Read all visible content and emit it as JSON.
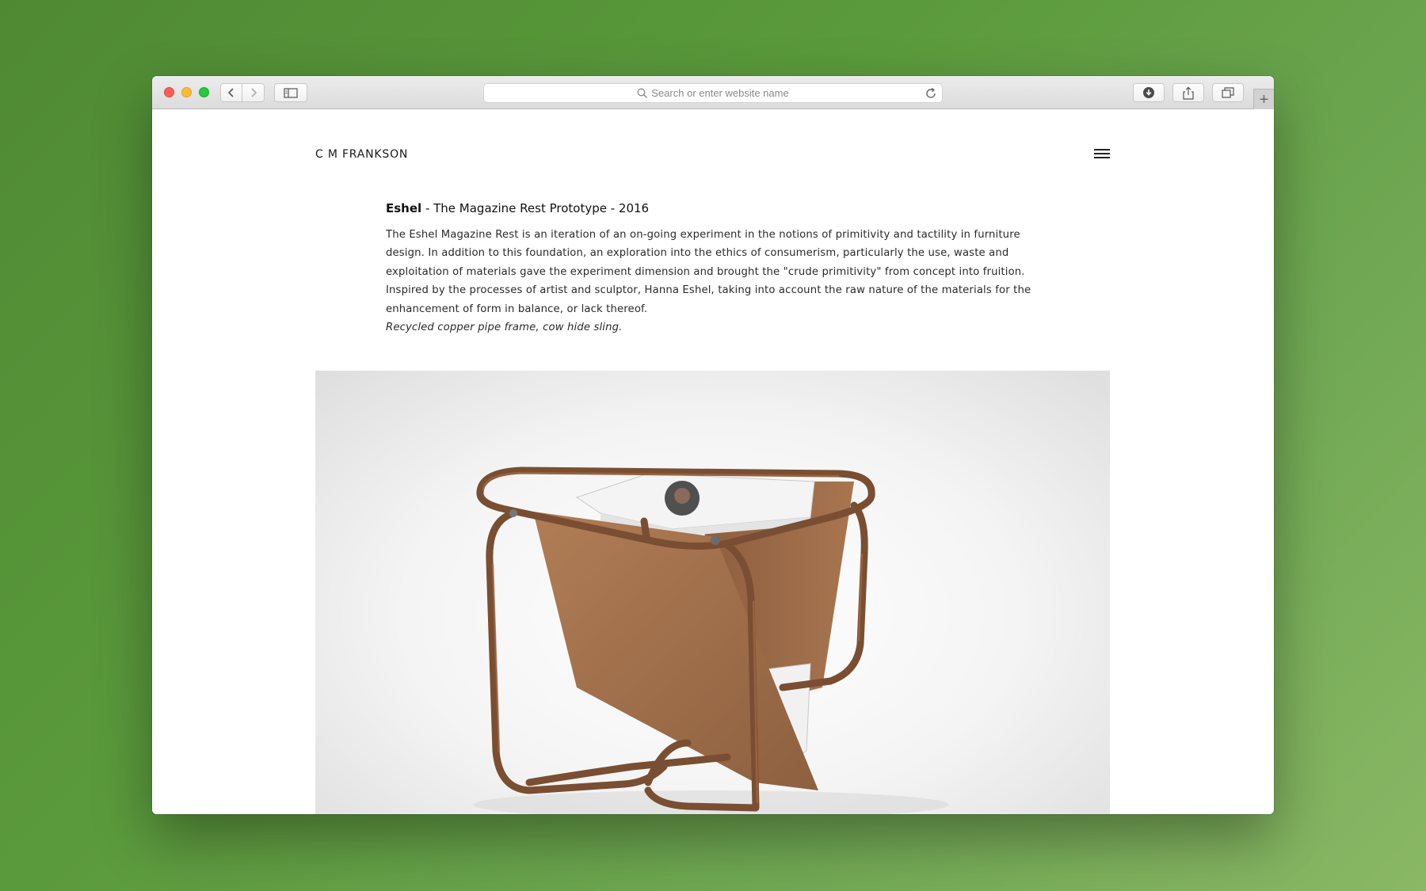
{
  "browser": {
    "address_placeholder": "Search or enter website name",
    "newtab_label": "+"
  },
  "site": {
    "brand": "C M FRANKSON"
  },
  "article": {
    "title_name": "Eshel",
    "title_rest": " - The Magazine Rest Prototype - 2016",
    "description": "The Eshel Magazine Rest is an iteration of an on-going experiment in the notions of primitivity and tactility in furniture design. In addition to this foundation, an exploration into the ethics of consumerism, particularly the use, waste and exploitation of materials gave the experiment dimension and brought the \"crude primitivity\" from concept into fruition. Inspired by the processes of artist and sculptor, Hanna Eshel, taking into account the raw nature of the materials for the enhancement of form in balance, or lack thereof.",
    "materials": "Recycled copper pipe frame, cow hide sling."
  },
  "colors": {
    "background": "#5b9a3c",
    "copper": "#8a5a3a",
    "leather": "#a87650"
  }
}
